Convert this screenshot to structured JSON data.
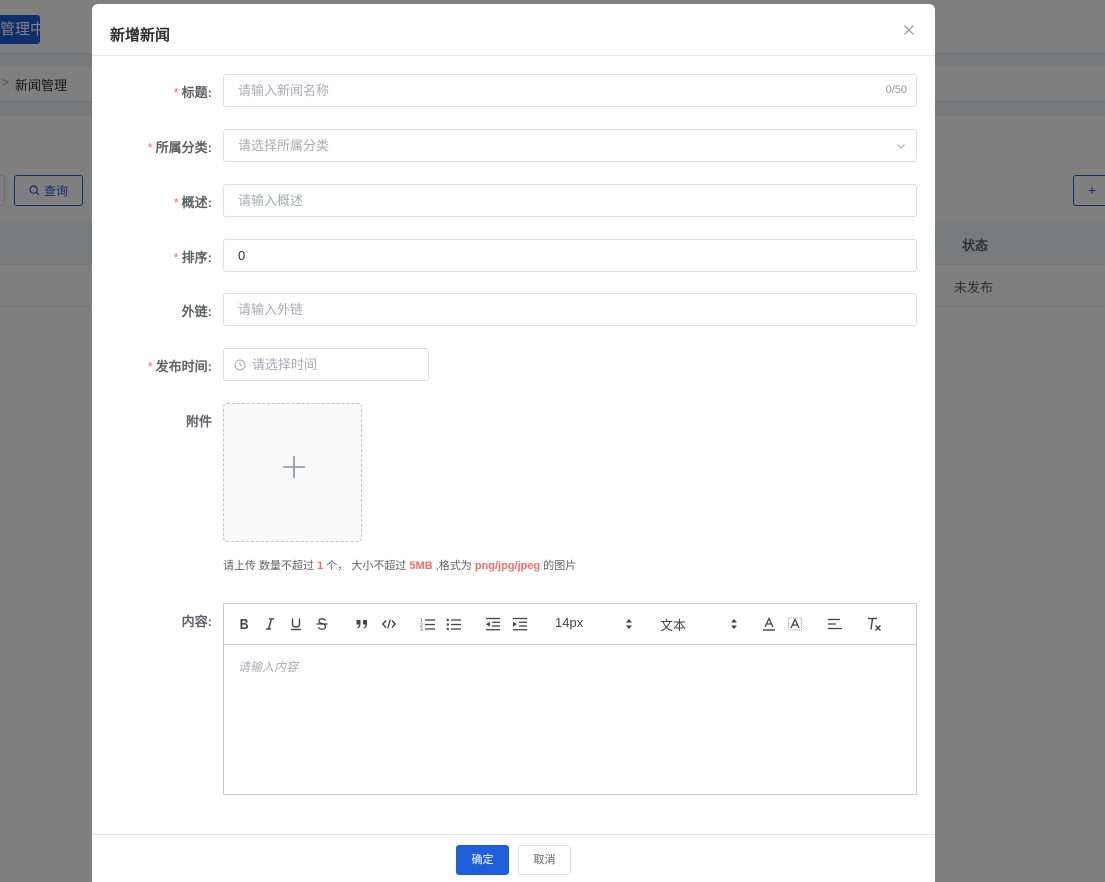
{
  "background": {
    "logo_text": "管理中心",
    "breadcrumb_separator": ">",
    "breadcrumb": "新闻管理",
    "query_button": "查询",
    "add_button": "+",
    "table_header_status": "状态",
    "table_row_status": "未发布"
  },
  "dialog": {
    "title": "新增新闻",
    "close_icon": "close-icon",
    "fields": {
      "title": {
        "label": "标题:",
        "placeholder": "请输入新闻名称",
        "counter": "0/50",
        "required": true
      },
      "category": {
        "label": "所属分类:",
        "placeholder": "请选择所属分类",
        "required": true
      },
      "summary": {
        "label": "概述:",
        "placeholder": "请输入概述",
        "required": true
      },
      "sort": {
        "label": "排序:",
        "value": "0",
        "required": true
      },
      "link": {
        "label": "外链:",
        "placeholder": "请输入外链",
        "required": false
      },
      "publish_time": {
        "label": "发布时间:",
        "placeholder": "请选择时间",
        "required": true
      },
      "attachment": {
        "label": "附件"
      },
      "content": {
        "label": "内容:",
        "placeholder": "请输入内容"
      }
    },
    "required_mark": "*",
    "upload_tip": {
      "prefix": "请上传 数量不超过 ",
      "count": "1",
      "mid1": " 个， 大小不超过 ",
      "size": "5MB",
      "mid2": " ,格式为 ",
      "formats": "png/jpg/jpeg",
      "suffix": " 的图片"
    },
    "toolbar": {
      "font_size": "14px",
      "block_type": "文本"
    },
    "footer": {
      "ok": "确定",
      "cancel": "取消"
    }
  },
  "colors": {
    "primary": "#1e5fd9",
    "required": "#f56c6c",
    "placeholder": "#a8abb2"
  }
}
